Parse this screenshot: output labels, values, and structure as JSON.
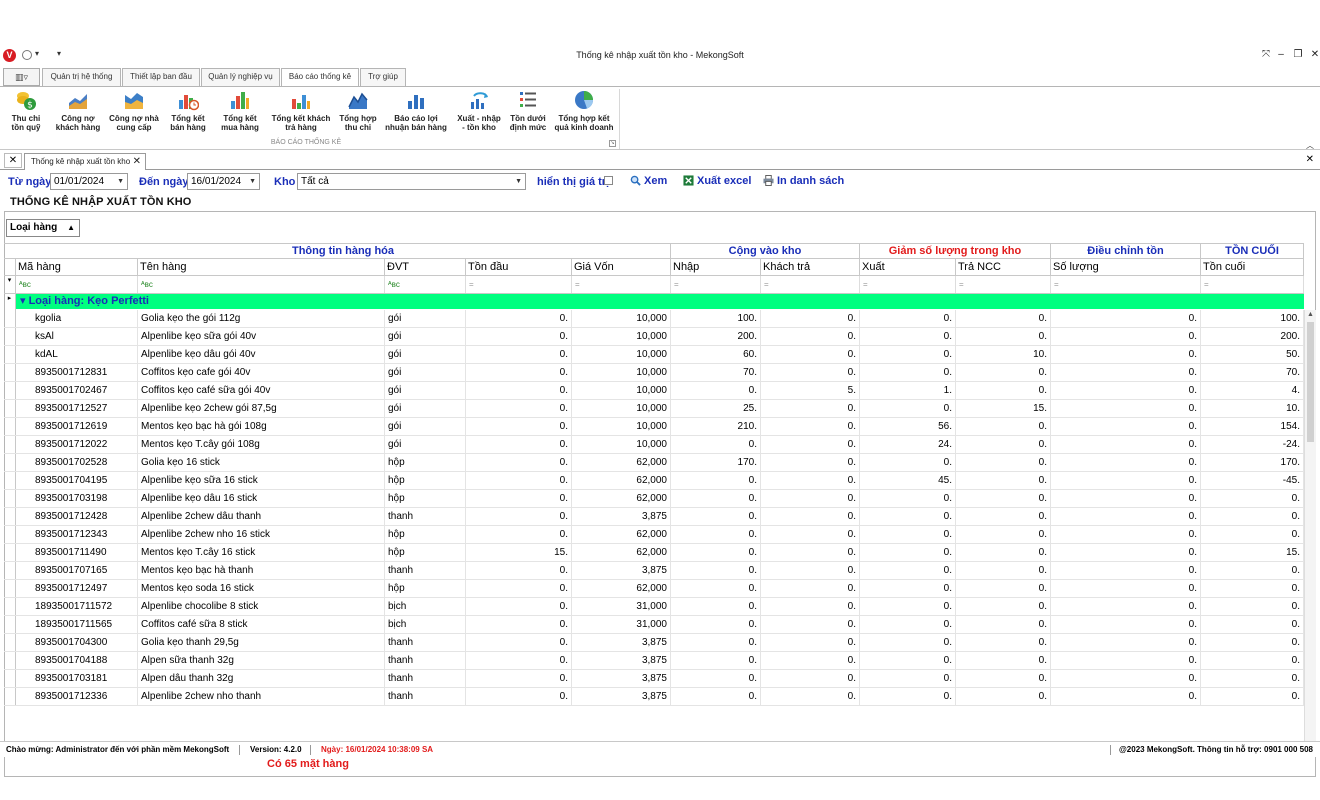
{
  "window": {
    "title": "Thống kê nhập xuất tồn kho - MekongSoft",
    "logo": "V"
  },
  "ribbon": {
    "tabs": [
      "Quản trị hệ thống",
      "Thiết lập ban đầu",
      "Quản lý nghiệp vụ",
      "Báo cáo thống kê",
      "Trợ giúp"
    ],
    "active_tab": "Báo cáo thống kê",
    "group_caption": "BÁO CÁO THỐNG KÊ",
    "buttons": [
      {
        "label": "Thu chi\ntồn quỹ",
        "icon": "coins-dollar-icon"
      },
      {
        "label": "Công nợ\nkhách hàng",
        "icon": "area-chart-icon"
      },
      {
        "label": "Công nợ nhà\ncung cấp",
        "icon": "area-chart-icon"
      },
      {
        "label": "Tổng kết\nbán hàng",
        "icon": "bar-chart-clock-icon"
      },
      {
        "label": "Tổng kết\nmua hàng",
        "icon": "bar-chart-icon"
      },
      {
        "label": "Tổng kết khách\ntrả hàng",
        "icon": "bar-chart-icon"
      },
      {
        "label": "Tổng hợp\nthu chi",
        "icon": "line-chart-icon"
      },
      {
        "label": "Báo cáo lợi\nnhuận bán hàng",
        "icon": "bar-chart-icon"
      },
      {
        "label": "Xuất - nhập\n- tồn kho",
        "icon": "refresh-chart-icon"
      },
      {
        "label": "Tồn dưới\nđịnh mức",
        "icon": "list-icon"
      },
      {
        "label": "Tổng hợp kết\nquả kinh doanh",
        "icon": "pie-chart-icon"
      }
    ]
  },
  "doc_tab": {
    "label": "Thống kê nhập xuất tồn kho"
  },
  "filters": {
    "from_label": "Từ ngày",
    "from_value": "01/01/2024",
    "to_label": "Đến ngày",
    "to_value": "16/01/2024",
    "kho_label": "Kho",
    "kho_value": "Tất cả",
    "show_value_label": "hiển thị giá trị",
    "view_label": "Xem",
    "excel_label": "Xuất excel",
    "print_label": "In danh sách"
  },
  "report_title": "THỐNG KÊ NHẬP XUẤT TỒN KHO",
  "group_panel": {
    "label": "Loại hàng"
  },
  "grid": {
    "bands": [
      {
        "label": "Thông tin hàng hóa",
        "color": "#1a2eb8"
      },
      {
        "label": "Cộng vào kho",
        "color": "#1a2eb8"
      },
      {
        "label": "Giảm số lượng trong kho",
        "color": "#e21b1b"
      },
      {
        "label": "Điều chỉnh tồn",
        "color": "#1a2eb8"
      },
      {
        "label": "TỒN CUỐI",
        "color": "#1a2eb8"
      }
    ],
    "columns": [
      "Mã hàng",
      "Tên hàng",
      "ĐVT",
      "Tồn đầu",
      "Giá Vốn",
      "Nhập",
      "Khách trả",
      "Xuất",
      "Trả NCC",
      "Số lượng",
      "Tồn cuối"
    ],
    "group_row": "Loại hàng: Kẹo Perfetti",
    "rows": [
      [
        "kgolia",
        "Golia kẹo the gói 112g",
        "gói",
        "0.",
        "10,000",
        "100.",
        "0.",
        "0.",
        "0.",
        "0.",
        "100."
      ],
      [
        "ksAl",
        "Alpenlibe kẹo sữa gói 40v",
        "gói",
        "0.",
        "10,000",
        "200.",
        "0.",
        "0.",
        "0.",
        "0.",
        "200."
      ],
      [
        "kdAL",
        "Alpenlibe kẹo dâu gói 40v",
        "gói",
        "0.",
        "10,000",
        "60.",
        "0.",
        "0.",
        "10.",
        "0.",
        "50."
      ],
      [
        "8935001712831",
        "Coffitos kẹo cafe gói 40v",
        "gói",
        "0.",
        "10,000",
        "70.",
        "0.",
        "0.",
        "0.",
        "0.",
        "70."
      ],
      [
        "8935001702467",
        "Coffitos kẹo café sữa gói 40v",
        "gói",
        "0.",
        "10,000",
        "0.",
        "5.",
        "1.",
        "0.",
        "0.",
        "4."
      ],
      [
        "8935001712527",
        "Alpenlibe kẹo 2chew gói 87,5g",
        "gói",
        "0.",
        "10,000",
        "25.",
        "0.",
        "0.",
        "15.",
        "0.",
        "10."
      ],
      [
        "8935001712619",
        "Mentos kẹo bạc hà gói 108g",
        "gói",
        "0.",
        "10,000",
        "210.",
        "0.",
        "56.",
        "0.",
        "0.",
        "154."
      ],
      [
        "8935001712022",
        "Mentos kẹo T.cây gói 108g",
        "gói",
        "0.",
        "10,000",
        "0.",
        "0.",
        "24.",
        "0.",
        "0.",
        "-24."
      ],
      [
        "8935001702528",
        "Golia kẹo 16 stick",
        "hộp",
        "0.",
        "62,000",
        "170.",
        "0.",
        "0.",
        "0.",
        "0.",
        "170."
      ],
      [
        "8935001704195",
        "Alpenlibe kẹo sữa 16 stick",
        "hộp",
        "0.",
        "62,000",
        "0.",
        "0.",
        "45.",
        "0.",
        "0.",
        "-45."
      ],
      [
        "8935001703198",
        "Alpenlibe kẹo dâu 16 stick",
        "hộp",
        "0.",
        "62,000",
        "0.",
        "0.",
        "0.",
        "0.",
        "0.",
        "0."
      ],
      [
        "8935001712428",
        "Alpenlibe 2chew dâu thanh",
        "thanh",
        "0.",
        "3,875",
        "0.",
        "0.",
        "0.",
        "0.",
        "0.",
        "0."
      ],
      [
        "8935001712343",
        "Alpenlibe 2chew nho 16 stick",
        "hộp",
        "0.",
        "62,000",
        "0.",
        "0.",
        "0.",
        "0.",
        "0.",
        "0."
      ],
      [
        "8935001711490",
        "Mentos kẹo T.cây 16 stick",
        "hộp",
        "15.",
        "62,000",
        "0.",
        "0.",
        "0.",
        "0.",
        "0.",
        "15."
      ],
      [
        "8935001707165",
        "Mentos kẹo bạc hà thanh",
        "thanh",
        "0.",
        "3,875",
        "0.",
        "0.",
        "0.",
        "0.",
        "0.",
        "0."
      ],
      [
        "8935001712497",
        "Mentos kẹo soda 16 stick",
        "hộp",
        "0.",
        "62,000",
        "0.",
        "0.",
        "0.",
        "0.",
        "0.",
        "0."
      ],
      [
        "18935001711572",
        "Alpenlibe chocolibe 8 stick",
        "bịch",
        "0.",
        "31,000",
        "0.",
        "0.",
        "0.",
        "0.",
        "0.",
        "0."
      ],
      [
        "18935001711565",
        "Coffitos café sữa 8 stick",
        "bịch",
        "0.",
        "31,000",
        "0.",
        "0.",
        "0.",
        "0.",
        "0.",
        "0."
      ],
      [
        "8935001704300",
        "Golia kẹo thanh 29,5g",
        "thanh",
        "0.",
        "3,875",
        "0.",
        "0.",
        "0.",
        "0.",
        "0.",
        "0."
      ],
      [
        "8935001704188",
        "Alpen sữa thanh 32g",
        "thanh",
        "0.",
        "3,875",
        "0.",
        "0.",
        "0.",
        "0.",
        "0.",
        "0."
      ],
      [
        "8935001703181",
        "Alpen dâu thanh 32g",
        "thanh",
        "0.",
        "3,875",
        "0.",
        "0.",
        "0.",
        "0.",
        "0.",
        "0."
      ],
      [
        "8935001712336",
        "Alpenlibe 2chew nho thanh",
        "thanh",
        "0.",
        "3,875",
        "0.",
        "0.",
        "0.",
        "0.",
        "0.",
        "0."
      ]
    ],
    "footer_count": "Có 65 mặt hàng"
  },
  "status": {
    "welcome": "Chào mừng: Administrator đến với phần mềm MekongSoft",
    "version": "Version: 4.2.0",
    "date": "Ngày: 16/01/2024 10:38:09 SA",
    "copyright": "@2023 MekongSoft. Thông tin hỗ trợ: 0901 000 508"
  },
  "colors": {
    "accent_blue": "#1a2eb8",
    "alert_red": "#e21b1b",
    "group_green": "#00ff80"
  }
}
